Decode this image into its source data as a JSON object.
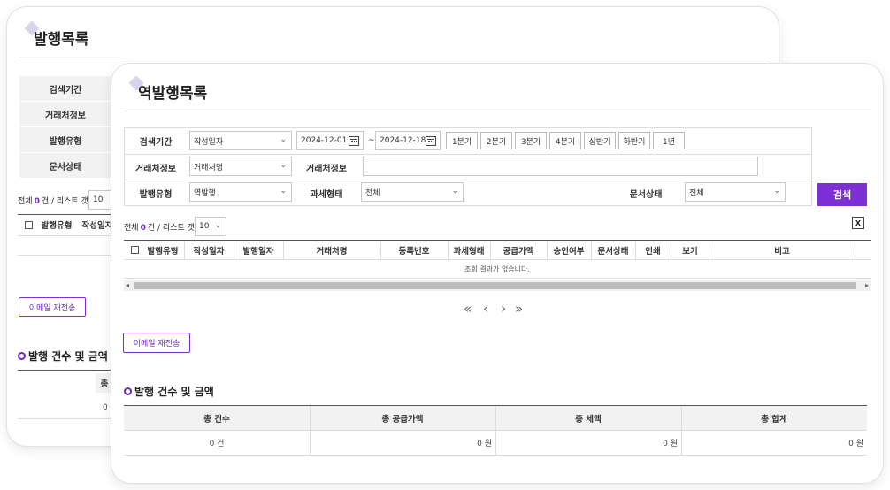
{
  "back": {
    "title": "발행목록",
    "search_labels": [
      "검색기간",
      "거래처정보",
      "발행유형",
      "문서상태"
    ],
    "list_count_prefix": "전체",
    "list_count_value": "0",
    "list_count_suffix": "건 / 리스트 갯수",
    "list_size": "10",
    "table_headers": [
      "발행유형",
      "작성일자"
    ],
    "resend_email": "이메일 재전송",
    "summary_title": "발행 건수 및 금액",
    "summary_header_partial": "총",
    "summary_value_partial": "0"
  },
  "front": {
    "title": "역발행목록",
    "search": {
      "period_label": "검색기간",
      "period_type": "작성일자",
      "date_from": "2024-12-01",
      "tilde": "~",
      "date_to": "2024-12-18",
      "quick_buttons": [
        "1분기",
        "2분기",
        "3분기",
        "4분기",
        "상반기",
        "하반기",
        "1년"
      ],
      "partner_label": "거래처정보",
      "partner_type": "거래처명",
      "partner_label2": "거래처정보",
      "partner_value": "",
      "issue_type_label": "발행유형",
      "issue_type": "역발행",
      "tax_type_label": "과세형태",
      "tax_type": "전체",
      "doc_status_label": "문서상태",
      "doc_status": "전체",
      "search_button": "검색"
    },
    "list_count_prefix": "전체",
    "list_count_value": "0",
    "list_count_suffix": "건 / 리스트 갯수",
    "list_size": "10",
    "excel_icon_text": "X",
    "table_headers": [
      "발행유형",
      "작성일자",
      "발행일자",
      "거래처명",
      "등록번호",
      "과세형태",
      "공급가액",
      "승인여부",
      "문서상태",
      "인쇄",
      "보기",
      "비고"
    ],
    "empty_message": "조회 결과가 없습니다.",
    "pager": {
      "first": "«",
      "prev": "‹",
      "next": "›",
      "last": "»"
    },
    "resend_email": "이메일 재전송",
    "summary": {
      "title": "발행 건수 및 금액",
      "headers": [
        "총 건수",
        "총 공급가액",
        "총 세액",
        "총 합계"
      ],
      "values": [
        "0 건",
        "0 원",
        "0 원",
        "0 원"
      ]
    }
  }
}
